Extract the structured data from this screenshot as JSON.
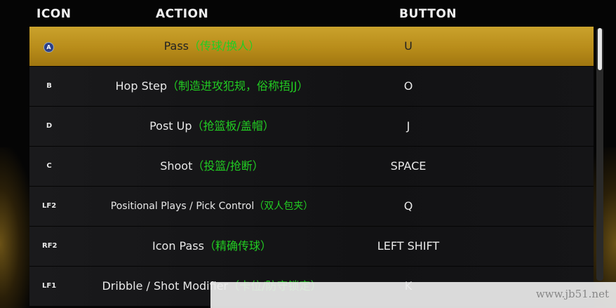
{
  "headers": {
    "icon": "ICON",
    "action": "ACTION",
    "button": "BUTTON"
  },
  "rows": [
    {
      "icon": "A",
      "icon_style": "circle",
      "action": "Pass",
      "action_cn": "（传球/换人）",
      "button": "U",
      "selected": true
    },
    {
      "icon": "B",
      "icon_style": "plain",
      "action": "Hop Step",
      "action_cn": "（制造进攻犯规，俗称捂JJ）",
      "button": "O",
      "selected": false
    },
    {
      "icon": "D",
      "icon_style": "plain",
      "action": "Post Up",
      "action_cn": "（抢篮板/盖帽）",
      "button": "J",
      "selected": false
    },
    {
      "icon": "C",
      "icon_style": "plain",
      "action": "Shoot",
      "action_cn": "（投篮/抢断）",
      "button": "SPACE",
      "selected": false
    },
    {
      "icon": "LF2",
      "icon_style": "plain",
      "action": "Positional Plays / Pick Control",
      "action_cn": "（双人包夹）",
      "button": "Q",
      "selected": false
    },
    {
      "icon": "RF2",
      "icon_style": "plain",
      "action": "Icon Pass",
      "action_cn": "（精确传球）",
      "button": "LEFT SHIFT",
      "selected": false
    },
    {
      "icon": "LF1",
      "icon_style": "plain",
      "action": "Dribble / Shot Modifier",
      "action_cn": "（卡位/防守锁定）",
      "button": "K",
      "selected": false
    }
  ],
  "watermark": "www.jb51.net",
  "colors": {
    "selected_bg": "#c39a26",
    "chinese_text": "#22cc22",
    "row_bg": "#151517"
  }
}
